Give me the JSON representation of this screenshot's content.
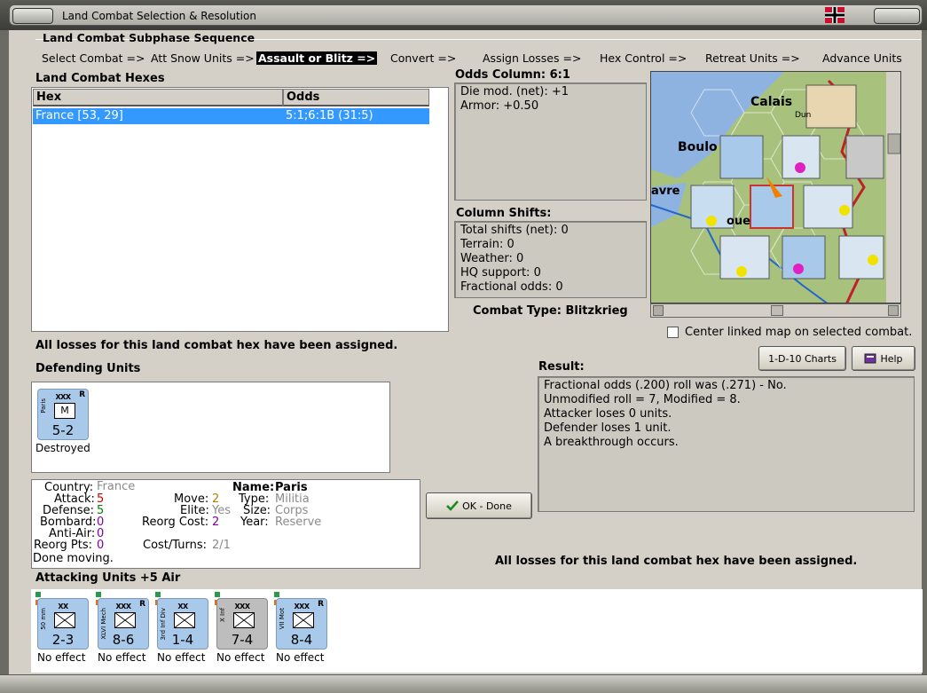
{
  "window": {
    "title": "Land Combat Selection & Resolution"
  },
  "subphase": {
    "heading": "Land Combat Subphase Sequence",
    "steps": [
      "Select Combat =>",
      "Att Snow Units =>",
      "Assault or Blitz =>",
      "Convert =>",
      "Assign Losses =>",
      "Hex Control =>",
      "Retreat Units =>",
      "Advance Units"
    ],
    "active_step": "Assault or Blitz =>"
  },
  "hexes": {
    "heading": "Land Combat Hexes",
    "columns": [
      "Hex",
      "Odds"
    ],
    "rows": [
      {
        "hex": "France [53, 29]",
        "odds": "5:1;6:1B (31:5)"
      }
    ]
  },
  "odds": {
    "heading": "Odds Column: 6:1",
    "lines": [
      "Die mod. (net): +1",
      "Armor: +0.50"
    ]
  },
  "shifts": {
    "heading": "Column Shifts:",
    "lines": [
      "Total shifts (net): 0",
      "Terrain: 0",
      "Weather: 0",
      "HQ support: 0",
      "Fractional odds: 0"
    ]
  },
  "combat_type": "Combat Type:  Blitzkrieg",
  "map": {
    "labels": [
      "Calais",
      "Boulo",
      "avre",
      "oue",
      "Dun"
    ],
    "scroll_position": 0.5,
    "center_linked_label": "Center linked map on selected combat.",
    "center_linked_checked": false
  },
  "losses_assigned_msg": "All losses for this land combat hex have been assigned.",
  "buttons": {
    "charts": "1-D-10 Charts",
    "help": "Help",
    "ok": "OK - Done"
  },
  "result": {
    "heading": "Result:",
    "lines": [
      "Fractional odds (.200) roll was (.271)  - No.",
      "Unmodified roll = 7, Modified = 8.",
      "Attacker loses 0 units.",
      "Defender loses 1 unit.",
      "A breakthrough occurs."
    ]
  },
  "defending": {
    "heading": "Defending Units",
    "units": [
      {
        "size": "XXX",
        "side": "Paris",
        "type": "M",
        "stats": "5-2",
        "reserve": "R",
        "caption": "Destroyed"
      }
    ]
  },
  "unit_details": {
    "country_label": "Country:",
    "country": "France",
    "attack_label": "Attack:",
    "attack": "5",
    "defense_label": "Defense:",
    "defense": "5",
    "bombard_label": "Bombard:",
    "bombard": "0",
    "antiair_label": "Anti-Air:",
    "antiair": "0",
    "reorg_pts_label": "Reorg Pts:",
    "reorg_pts": "0",
    "move_label": "Move:",
    "move": "2",
    "elite_label": "Elite:",
    "elite": "Yes",
    "reorg_cost_label": "Reorg Cost:",
    "reorg_cost": "2",
    "cost_turns_label": "Cost/Turns:",
    "cost_turns": "2/1",
    "name_label": "Name:",
    "name": "Paris",
    "type_label": "Type:",
    "type": "Militia",
    "size_label": "Size:",
    "size": "Corps",
    "year_label": "Year:",
    "year": "Reserve",
    "status": "Done moving."
  },
  "attacking": {
    "heading": "Attacking Units +5 Air",
    "units": [
      {
        "size": "XX",
        "side": "50 mm",
        "stats": "2-3",
        "reserve": "",
        "caption": "No effect"
      },
      {
        "size": "XXX",
        "side": "XLVI Mech",
        "stats": "8-6",
        "reserve": "R",
        "caption": "No effect"
      },
      {
        "size": "XX",
        "side": "3rd Inf Div",
        "stats": "1-4",
        "reserve": "",
        "caption": "No effect"
      },
      {
        "size": "XXX",
        "side": "X Inf",
        "stats": "7-4",
        "reserve": "",
        "caption": "No effect"
      },
      {
        "size": "XXX",
        "side": "VII Mot",
        "stats": "8-4",
        "reserve": "R",
        "caption": "No effect"
      }
    ]
  },
  "colors": {
    "selection": "#3399ff",
    "counter_blue": "#a9c9ea",
    "counter_grey": "#bdbdbd",
    "attack_red": "#c00000",
    "defense_green": "#008000",
    "purple": "#8000a0"
  }
}
